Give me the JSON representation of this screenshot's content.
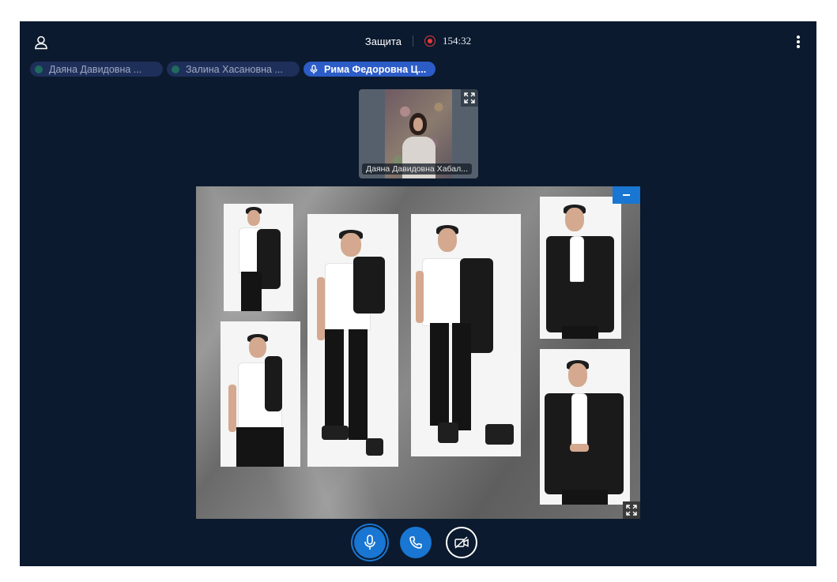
{
  "header": {
    "title": "Защита",
    "timer": "154:32",
    "recording_color": "#e83a3a"
  },
  "participants": [
    {
      "name": "Даяна Давидовна ...",
      "active": false
    },
    {
      "name": "Залина Хасановна ...",
      "active": false
    },
    {
      "name": "Рима Федоровна Ц...",
      "active": true
    }
  ],
  "video_tile": {
    "label": "Даяна Давидовна Хабал..."
  },
  "icons": {
    "user": "user-icon",
    "menu": "more-vertical-icon",
    "expand": "expand-icon",
    "minimize": "minimize-icon",
    "microphone": "microphone-icon",
    "phone": "phone-icon",
    "camera_off": "camera-off-icon"
  },
  "colors": {
    "background": "#0b1a2e",
    "accent": "#1976d2",
    "chip_active": "#2c5cc7",
    "chip_inactive": "#1e2f5a"
  }
}
